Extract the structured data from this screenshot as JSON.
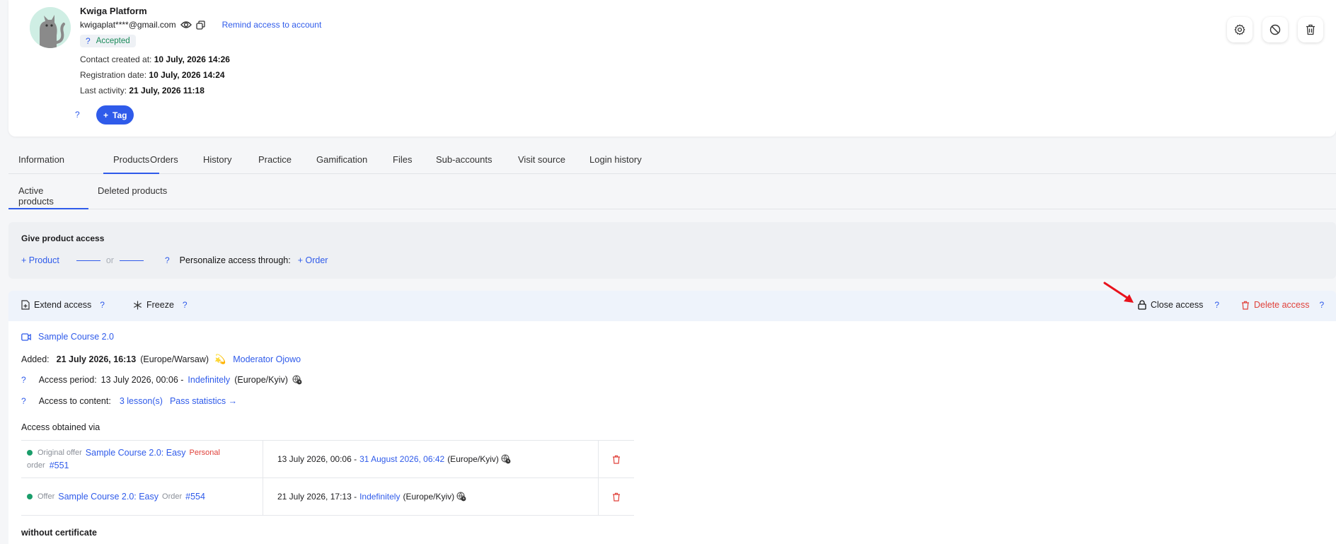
{
  "profile": {
    "name": "Kwiga Platform",
    "email": "kwigaplat****@gmail.com",
    "remind_link": "Remind access to account",
    "status_q": "?",
    "status": "Accepted",
    "contact_created_label": "Contact created at:",
    "contact_created_value": "10 July, 2026 14:26",
    "registration_label": "Registration date:",
    "registration_value": "10 July, 2026 14:24",
    "last_activity_label": "Last activity:",
    "last_activity_value": "21 July, 2026 11:18",
    "tag_q": "?",
    "tag_button": "Tag",
    "tag_plus": "+"
  },
  "tabs": [
    {
      "label": "Information"
    },
    {
      "label": "Products"
    },
    {
      "label": "Orders"
    },
    {
      "label": "History"
    },
    {
      "label": "Practice"
    },
    {
      "label": "Gamification"
    },
    {
      "label": "Files"
    },
    {
      "label": "Sub-accounts"
    },
    {
      "label": "Visit source"
    },
    {
      "label": "Login history"
    }
  ],
  "subtabs": [
    {
      "label": "Active products"
    },
    {
      "label": "Deleted products"
    }
  ],
  "give_access": {
    "title": "Give product access",
    "product_link": "+ Product",
    "or": "or",
    "q": "?",
    "personalize_label": "Personalize access through:",
    "order_link": "+ Order"
  },
  "actions": {
    "extend": "Extend access",
    "freeze": "Freeze",
    "close": "Close access",
    "delete": "Delete access",
    "q": "?"
  },
  "product": {
    "name": "Sample Course 2.0",
    "added_label": "Added:",
    "added_value": "21 July 2026, 16:13",
    "added_tz": "(Europe/Warsaw)",
    "moderator": "Moderator Ojowo",
    "period_q": "?",
    "period_label": "Access period:",
    "period_start": "13 July 2026, 00:06 -",
    "period_end": "Indefinitely",
    "period_tz": "(Europe/Kyiv)",
    "content_q": "?",
    "content_label": "Access to content:",
    "lessons": "3 lesson(s)",
    "stats_link": "Pass statistics →",
    "obtained_title": "Access obtained via",
    "certificate": "without certificate"
  },
  "access_rows": [
    {
      "type_label": "Original offer",
      "offer": "Sample Course 2.0: Easy",
      "personal": "Personal",
      "order_label": "order",
      "order": "#551",
      "start": "13 July 2026, 00:06 -",
      "end": "31 August 2026, 06:42",
      "tz": "(Europe/Kyiv)"
    },
    {
      "type_label": "Offer",
      "offer": "Sample Course 2.0: Easy",
      "order_label": "Order",
      "order": "#554",
      "start": "21 July 2026, 17:13 -",
      "end": "Indefinitely",
      "tz": "(Europe/Kyiv)"
    }
  ],
  "colors": {
    "accent": "#2f5bea",
    "danger": "#e0413a",
    "success": "#1a9d6a",
    "annotation_arrow": "#e8121c"
  }
}
